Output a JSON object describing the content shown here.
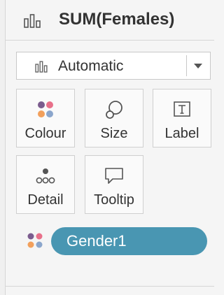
{
  "header": {
    "icon": "bar-chart-icon",
    "title": "SUM(Females)"
  },
  "mark_type": {
    "icon": "bar-chart-icon",
    "value": "Automatic"
  },
  "cards": [
    {
      "label": "Colour",
      "icon": "colour-dots-icon"
    },
    {
      "label": "Size",
      "icon": "size-circles-icon"
    },
    {
      "label": "Label",
      "icon": "text-label-icon"
    },
    {
      "label": "Detail",
      "icon": "detail-dots-icon"
    },
    {
      "label": "Tooltip",
      "icon": "speech-bubble-icon"
    }
  ],
  "pill": {
    "label": "Gender1",
    "icon": "colour-dots-icon",
    "color": "#4996b2"
  },
  "colors": {
    "pink": "#e8708a",
    "orange": "#f2a05c",
    "purple": "#7b5c8e",
    "blue": "#8ba6cc"
  }
}
